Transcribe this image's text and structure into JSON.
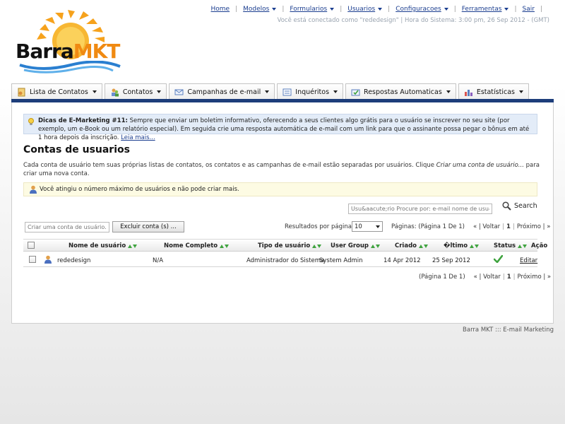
{
  "brand": {
    "logo_part1": "Barra",
    "logo_part2": "MKT"
  },
  "topnav": {
    "items": [
      {
        "label": "Home",
        "caret": false
      },
      {
        "label": "Modelos",
        "caret": true
      },
      {
        "label": "Formularios",
        "caret": true
      },
      {
        "label": "Usuarios",
        "caret": true
      },
      {
        "label": "Configuracoes",
        "caret": true
      },
      {
        "label": "Ferramentas",
        "caret": true
      },
      {
        "label": "Sair",
        "caret": false
      }
    ],
    "status_text": "Você está conectado como \"rededesign\" | Hora do Sistema: 3:00 pm, 26 Sep 2012 - (GMT)"
  },
  "tabs": [
    {
      "label": "Lista de Contatos",
      "icon": "contact-list-icon"
    },
    {
      "label": "Contatos",
      "icon": "contacts-icon"
    },
    {
      "label": "Campanhas de e-mail",
      "icon": "email-icon"
    },
    {
      "label": "Inquéritos",
      "icon": "survey-icon"
    },
    {
      "label": "Respostas Automaticas",
      "icon": "autoresponder-icon"
    },
    {
      "label": "Estatísticas",
      "icon": "stats-icon"
    }
  ],
  "tip": {
    "title": "Dicas de E-Marketing #11:",
    "text": " Sempre que enviar um boletim informativo, oferecendo a seus clientes algo grátis para o usuário se inscrever no seu site (por exemplo, um e-Book ou um relatório especial). Em seguida crie uma resposta automática de e-mail com um link para que o assinante possa pegar o bônus em até 1 hora depois da inscrição. ",
    "link": "Leia mais..."
  },
  "page": {
    "title": "Contas de usuarios",
    "description_1": "Cada conta de usuário tem suas próprias listas de contatos, os contatos e as campanhas de e-mail estão separadas por usuários. Clique ",
    "description_italic": "Criar uma conta de usuário...",
    "description_2": " para criar uma nova conta.",
    "warning": "Você atingiu o número máximo de usuários e não pode criar mais."
  },
  "search": {
    "placeholder": "Usu&aacute;rio Procure por: e-mail nome de usu&aa",
    "button_label": "Search"
  },
  "toolbar": {
    "create_placeholder": "Criar uma conta de usuário...",
    "delete_label": "Excluir conta (s) ...",
    "results_label": "Resultados por página:",
    "results_value": "10"
  },
  "pager_top": {
    "page_info": "Páginas: (Página 1 De 1)",
    "prev": "« | Voltar",
    "current": "1",
    "next": "Próximo | »"
  },
  "pager_bottom": {
    "page_info": "(Página 1 De 1)",
    "prev": "« | Voltar",
    "current": "1",
    "next": "Próximo | »"
  },
  "table": {
    "headers": [
      "Nome de usuário",
      "Nome Completo",
      "Tipo de usuário",
      "User Group",
      "Criado",
      "�ltimo",
      "Status",
      "Ação"
    ],
    "rows": [
      {
        "username": "rededesign",
        "full_name": "N/A",
        "user_type": "Administrador do Sistema",
        "group": "System Admin",
        "created": "14 Apr 2012",
        "last": "25 Sep 2012",
        "status": "active",
        "action": "Editar"
      }
    ]
  },
  "footer": "Barra MKT ::: E-mail Marketing",
  "colors": {
    "nav_bar": "#1d3d7a",
    "link": "#1a3d8f",
    "tip_bg": "#e3ecf8",
    "warn_bg": "#fdfbe3"
  }
}
